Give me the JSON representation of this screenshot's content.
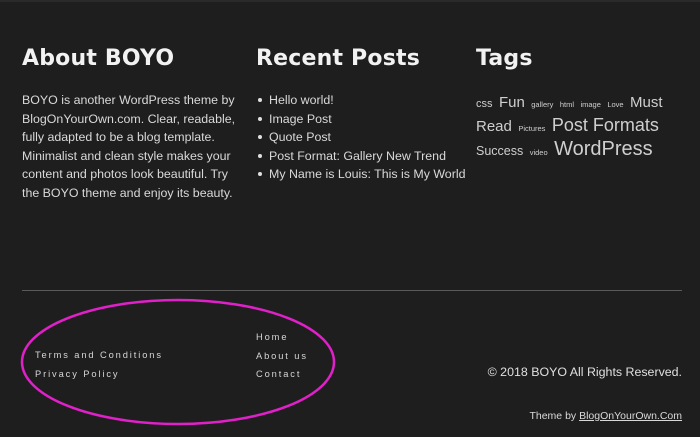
{
  "about": {
    "title": "About BOYO",
    "text": "BOYO is another WordPress theme by BlogOnYourOwn.com. Clear, readable, fully adapted to be a blog template. Minimalist and clean style makes your content and photos look beautiful. Try the BOYO theme and enjoy its beauty."
  },
  "recent_posts": {
    "title": "Recent Posts",
    "items": [
      "Hello world!",
      "Image Post",
      "Quote Post",
      "Post Format: Gallery New Trend",
      "My Name is Louis: This is My World"
    ]
  },
  "tags": {
    "title": "Tags",
    "items": [
      {
        "label": "css",
        "size": "small"
      },
      {
        "label": "Fun",
        "size": "large"
      },
      {
        "label": "gallery",
        "size": "tiny"
      },
      {
        "label": "html",
        "size": "tiny"
      },
      {
        "label": "image",
        "size": "tiny"
      },
      {
        "label": "Love",
        "size": "tiny"
      },
      {
        "label": "Must Read",
        "size": "large"
      },
      {
        "label": "Pictures",
        "size": "tiny"
      },
      {
        "label": "Post Formats",
        "size": "xlarge"
      },
      {
        "label": "Success",
        "size": "medium"
      },
      {
        "label": "video",
        "size": "tiny"
      },
      {
        "label": "WordPress",
        "size": "xxlarge"
      }
    ]
  },
  "footer": {
    "menu_left": [
      "Terms and Conditions",
      "Privacy Policy"
    ],
    "menu_right": [
      "Home",
      "About us",
      "Contact"
    ],
    "copyright": "© 2018 BOYO All Rights Reserved.",
    "theme_by_prefix": "Theme by ",
    "theme_by_link": "BlogOnYourOwn.Com"
  },
  "colors": {
    "background": "#1e1e1f",
    "text": "#d9d9d9",
    "annotation_ellipse": "#e020c8"
  }
}
